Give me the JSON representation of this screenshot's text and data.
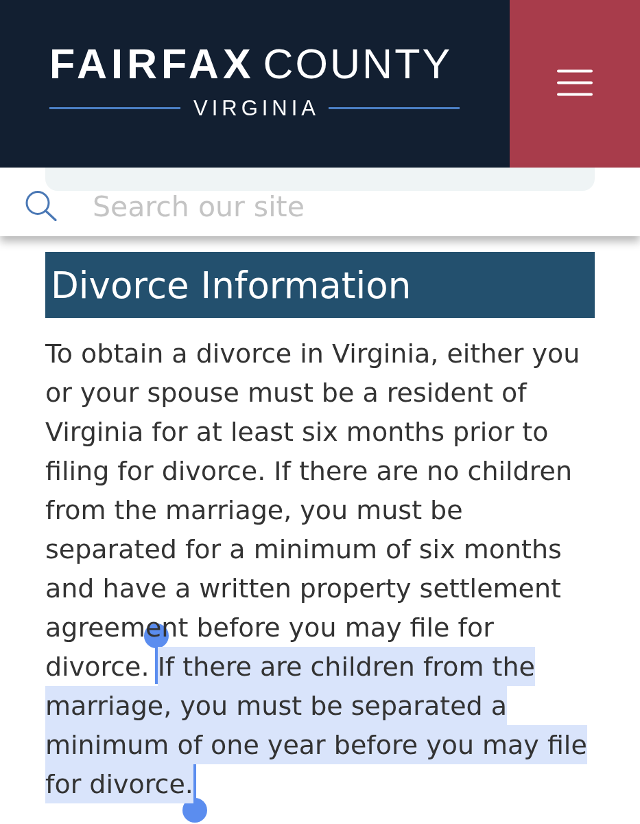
{
  "header": {
    "logo": {
      "wordmark": "**FAIRFAX** COUNTY",
      "subtitle": "VIRGINIA"
    }
  },
  "search": {
    "placeholder": "Search our site"
  },
  "heading": "Divorce Information",
  "paragraph": [
    {
      "text": "To obtain a divorce in Virginia, either you or your spouse must be a resident of Virginia for at least six months prior to filing for divorce. If there are no children from the marriage, you must be separated for a minimum of six months and have a written property settlement agreement before you may file for divorce. ",
      "selected": false
    },
    {
      "text": "If there are children from the marriage, you must be separated a minimum of one year before you may file for divorce.",
      "selected": true
    }
  ]
}
